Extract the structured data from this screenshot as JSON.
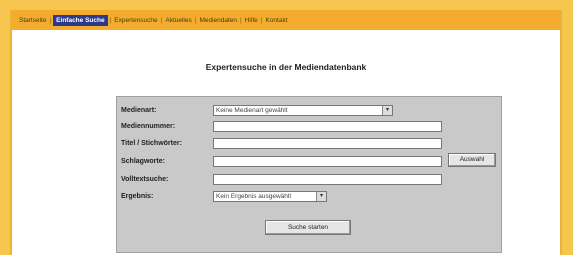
{
  "nav": {
    "items": [
      {
        "label": "Startseite",
        "active": false
      },
      {
        "label": "Einfache Suche",
        "active": true
      },
      {
        "label": "Expertensuche",
        "active": false
      },
      {
        "label": "Aktuelles",
        "active": false
      },
      {
        "label": "Mediendaten",
        "active": false
      },
      {
        "label": "Hilfe",
        "active": false
      },
      {
        "label": "Kontakt",
        "active": false
      }
    ]
  },
  "page": {
    "title": "Expertensuche in der Mediendatenbank"
  },
  "form": {
    "medienart_label": "Medienart:",
    "medienart_value": "Keine Medienart gewählt",
    "mediennummer_label": "Mediennummer:",
    "titel_label": "Titel / Stichwörter:",
    "schlagworte_label": "Schlagworte:",
    "volltext_label": "Volltextsuche:",
    "ergebnis_label": "Ergebnis:",
    "ergebnis_value": "Kein Ergebnis ausgewählt",
    "auswahl_button": "Auswahl",
    "submit_button": "Suche starten"
  }
}
